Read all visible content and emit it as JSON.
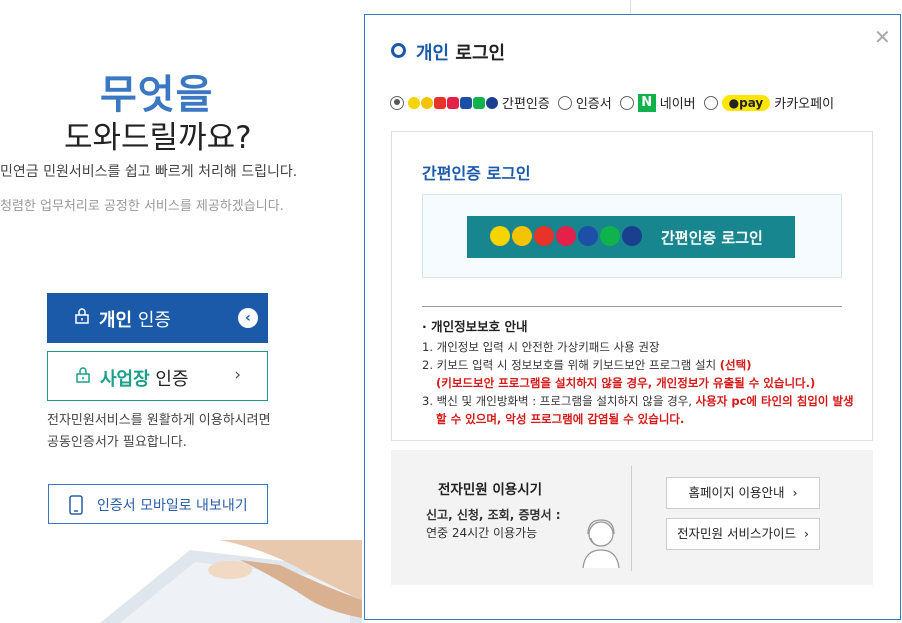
{
  "left": {
    "hero_line1": "무엇을",
    "hero_line2": "도와드릴까요?",
    "desc_line1": "민연금 민원서비스를 쉽고 빠르게 처리해 드립니다.",
    "desc_line2": "청렴한 업무처리로 공정한 서비스를 제공하겠습니다.",
    "personal_bold": "개인",
    "personal_rest": " 인증",
    "business_bold": "사업장",
    "business_rest": " 인증",
    "note_line1": "전자민원서비스를 원활하게 이용하시려면",
    "note_line2": "공동인증서가 필요합니다.",
    "mobile_export": "인증서 모바일로 내보내기"
  },
  "modal": {
    "title_blue": "개인",
    "title_rest": " 로그인",
    "close": "✕",
    "radio_options": [
      "간편인증",
      "인증서",
      "네이버",
      "카카오페이"
    ],
    "naver_letter": "N",
    "kakao_pay": "pay",
    "panel_title": "간편인증 로그인",
    "simple_auth_button": "간편인증 로그인",
    "privacy": {
      "heading": "· 개인정보보호 안내",
      "item1": "1. 개인정보 입력 시 안전한 가상키패드 사용 권장",
      "item2_prefix": "2. 키보드 입력 시 정보보호를 위해 키보드보안 프로그램 설치 ",
      "item2_red": "(선택)",
      "item2_note": "(키보드보안 프로그램을 설치하지 않을 경우, 개인정보가 유출될 수 있습니다.)",
      "item3_prefix": "3. 백신 및 개인방화벽 : 프로그램을 설치하지 않을 경우, ",
      "item3_red1": "사용자 pc에 타인의 침입이 발생",
      "item3_red2": "할 수 있으며, 악성 프로그램에 감염될 수 있습니다."
    },
    "info": {
      "title": "전자민원 이용시기",
      "sub1": "신고, 신청, 조회, 증명서 :",
      "sub2": "연중 24시간 이용가능",
      "btn_home": "홈페이지 이용안내",
      "btn_guide": "전자민원 서비스가이드"
    }
  },
  "colors": {
    "primary_blue": "#1b5aa8",
    "teal": "#17868e",
    "green": "#1aa08a",
    "warning_red": "#d61a1a"
  }
}
